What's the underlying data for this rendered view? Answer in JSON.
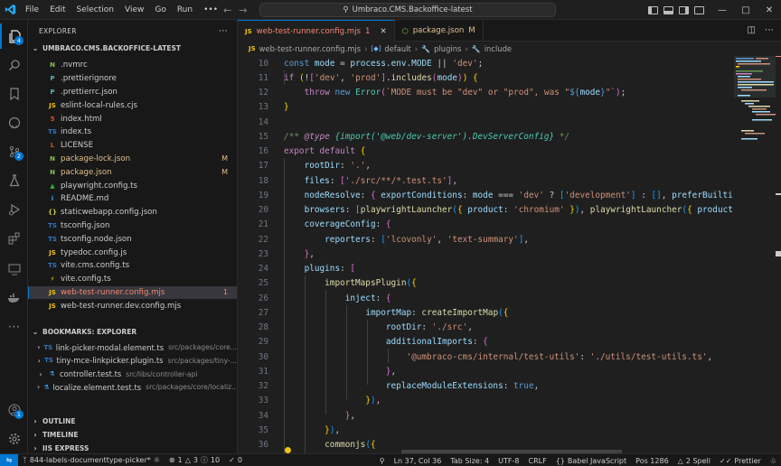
{
  "titlebar": {
    "menu": [
      "File",
      "Edit",
      "Selection",
      "View",
      "Go",
      "Run",
      "•••"
    ],
    "command_center": "Umbraco.CMS.Backoffice-latest",
    "window_controls": [
      "—",
      "□",
      "✕"
    ]
  },
  "activity": {
    "explorer_badge": "4",
    "scm_badge": "2",
    "accounts_badge": "1"
  },
  "sidebar": {
    "title": "EXPLORER",
    "root": "UMBRACO.CMS.BACKOFFICE-LATEST",
    "files": [
      {
        "name": ".nvmrc",
        "icon": "N",
        "color": "#8bc34a",
        "status": "",
        "cls": ""
      },
      {
        "name": ".prettierignore",
        "icon": "P",
        "color": "#56b3b4",
        "status": "",
        "cls": ""
      },
      {
        "name": ".prettierrc.json",
        "icon": "P",
        "color": "#56b3b4",
        "status": "",
        "cls": ""
      },
      {
        "name": "eslint-local-rules.cjs",
        "icon": "JS",
        "color": "#f1c40f",
        "status": "",
        "cls": ""
      },
      {
        "name": "index.html",
        "icon": "5",
        "color": "#e44d26",
        "status": "",
        "cls": ""
      },
      {
        "name": "index.ts",
        "icon": "TS",
        "color": "#3178c6",
        "status": "",
        "cls": ""
      },
      {
        "name": "LICENSE",
        "icon": "L",
        "color": "#d35400",
        "status": "",
        "cls": ""
      },
      {
        "name": "package-lock.json",
        "icon": "N",
        "color": "#8bc34a",
        "status": "M",
        "cls": "mod"
      },
      {
        "name": "package.json",
        "icon": "N",
        "color": "#8bc34a",
        "status": "M",
        "cls": "mod"
      },
      {
        "name": "playwright.config.ts",
        "icon": "▲",
        "color": "#2ead33",
        "status": "",
        "cls": ""
      },
      {
        "name": "README.md",
        "icon": "i",
        "color": "#42a5f5",
        "status": "",
        "cls": ""
      },
      {
        "name": "staticwebapp.config.json",
        "icon": "{}",
        "color": "#cbcb41",
        "status": "",
        "cls": ""
      },
      {
        "name": "tsconfig.json",
        "icon": "TS",
        "color": "#3178c6",
        "status": "",
        "cls": ""
      },
      {
        "name": "tsconfig.node.json",
        "icon": "TS",
        "color": "#3178c6",
        "status": "",
        "cls": ""
      },
      {
        "name": "typedoc.config.js",
        "icon": "JS",
        "color": "#f1c40f",
        "status": "",
        "cls": ""
      },
      {
        "name": "vite.cms.config.ts",
        "icon": "TS",
        "color": "#3178c6",
        "status": "",
        "cls": ""
      },
      {
        "name": "vite.config.ts",
        "icon": "⚡",
        "color": "#ffc517",
        "status": "",
        "cls": ""
      },
      {
        "name": "web-test-runner.config.mjs",
        "icon": "JS",
        "color": "#f1c40f",
        "status": "1",
        "cls": "err"
      },
      {
        "name": "web-test-runner.dev.config.mjs",
        "icon": "JS",
        "color": "#f1c40f",
        "status": "",
        "cls": ""
      }
    ],
    "bookmarks_title": "BOOKMARKS: EXPLORER",
    "bookmarks": [
      {
        "name": "link-picker-modal.element.ts",
        "path": "src/packages/core..."
      },
      {
        "name": "tiny-mce-linkpicker.plugin.ts",
        "path": "src/packages/tiny-..."
      },
      {
        "name": "controller.test.ts",
        "path": "src/libs/controller-api"
      },
      {
        "name": "localize.element.test.ts",
        "path": "src/packages/core/localiz..."
      }
    ],
    "bottom_sections": [
      "OUTLINE",
      "TIMELINE",
      "IIS EXPRESS"
    ]
  },
  "tabs": [
    {
      "label": "web-test-runner.config.mjs",
      "suffix": "1",
      "close": "✕",
      "active": true
    },
    {
      "label": "package.json",
      "suffix": "M",
      "close": "",
      "active": false
    }
  ],
  "breadcrumb": [
    "web-test-runner.config.mjs",
    "default",
    "plugins",
    "include"
  ],
  "editor": {
    "lines": [
      {
        "n": "10",
        "html": "<span class='kw'>const</span> <span class='var'>mode</span> = <span class='var'>process</span>.<span class='var'>env</span>.<span class='var'>MODE</span> || <span class='str'>'dev'</span>;"
      },
      {
        "n": "11",
        "html": "<span class='kw2'>if</span> <span class='br1'>(</span>!<span class='br2'>[</span><span class='str'>'dev'</span>, <span class='str'>'prod'</span><span class='br2'>]</span>.<span class='fn'>includes</span><span class='br2'>(</span><span class='var'>mode</span><span class='br2'>)</span><span class='br1'>)</span> <span class='br1'>{</span>"
      },
      {
        "n": "12",
        "html": "    <span class='kw2'>throw</span> <span class='kw'>new</span> <span class='cls'>Error</span><span class='br2'>(</span><span class='str'>`MODE must be \"dev\" or \"prod\", was \"</span><span class='kw'>${</span><span class='var'>mode</span><span class='kw'>}</span><span class='str'>\"`</span><span class='br2'>)</span>;"
      },
      {
        "n": "13",
        "html": "<span class='br1'>}</span>"
      },
      {
        "n": "14",
        "html": ""
      },
      {
        "n": "15",
        "html": "<span class='cm'>/** </span><span class='kw2' style='font-style:italic'>@type</span><span class='cls' style='font-style:italic'> {import('@web/dev-server').DevServerConfig}</span><span class='cm'> */</span>"
      },
      {
        "n": "16",
        "html": "<span class='kw2'>export</span> <span class='kw2'>default</span> <span class='br1'>{</span>"
      },
      {
        "n": "17",
        "html": "    <span class='var'>rootDir</span>: <span class='str'>'.'</span>,"
      },
      {
        "n": "18",
        "html": "    <span class='var'>files</span>: <span class='br2'>[</span><span class='str'>'./src/**/*.test.ts'</span><span class='br2'>]</span>,"
      },
      {
        "n": "19",
        "html": "    <span class='var'>nodeResolve</span>: <span class='br2'>{</span> <span class='var'>exportConditions</span>: <span class='var'>mode</span> === <span class='str'>'dev'</span> ? <span class='br3'>[</span><span class='str'>'development'</span><span class='br3'>]</span> : <span class='br3'>[]</span>, <span class='var'>preferBuilti</span>"
      },
      {
        "n": "20",
        "html": "    <span class='var'>browsers</span>: <span class='br2'>[</span><span class='fn'>playwrightLauncher</span><span class='br3'>(</span><span class='br1'>{</span> <span class='var'>product</span>: <span class='str'>'chromium'</span> <span class='br1'>}</span><span class='br3'>)</span>, <span class='fn'>playwrightLauncher</span><span class='br3'>(</span><span class='br1'>{</span> <span class='var'>product</span>"
      },
      {
        "n": "21",
        "html": "    <span class='var'>coverageConfig</span>: <span class='br2'>{</span>"
      },
      {
        "n": "22",
        "html": "        <span class='var'>reporters</span>: <span class='br3'>[</span><span class='str'>'lcovonly'</span>, <span class='str'>'text-summary'</span><span class='br3'>]</span>,"
      },
      {
        "n": "23",
        "html": "    <span class='br2'>}</span>,"
      },
      {
        "n": "24",
        "html": "    <span class='var'>plugins</span>: <span class='br2'>[</span>"
      },
      {
        "n": "25",
        "html": "        <span class='fn'>importMapsPlugin</span><span class='br3'>(</span><span class='br1'>{</span>"
      },
      {
        "n": "26",
        "html": "            <span class='var'>inject</span>: <span class='br2'>{</span>"
      },
      {
        "n": "27",
        "html": "                <span class='var'>importMap</span>: <span class='fn'>createImportMap</span><span class='br3'>(</span><span class='br1'>{</span>"
      },
      {
        "n": "28",
        "html": "                    <span class='var'>rootDir</span>: <span class='str'>'./src'</span>,"
      },
      {
        "n": "29",
        "html": "                    <span class='var'>additionalImports</span>: <span class='br2'>{</span>"
      },
      {
        "n": "30",
        "html": "                        <span class='str'>'@umbraco-cms/internal/test-utils'</span>: <span class='str'>'./utils/test-utils.ts'</span>,"
      },
      {
        "n": "31",
        "html": "                    <span class='br2'>}</span>,"
      },
      {
        "n": "32",
        "html": "                    <span class='var'>replaceModuleExtensions</span>: <span class='kw'>true</span>,"
      },
      {
        "n": "33",
        "html": "                <span class='br1'>}</span><span class='br3'>)</span>,"
      },
      {
        "n": "34",
        "html": "            <span class='br2'>}</span>,"
      },
      {
        "n": "35",
        "html": "        <span class='br1'>}</span><span class='br3'>)</span>,"
      },
      {
        "n": "36",
        "html": "        <span class='fn'>commonjs</span><span class='br3'>(</span><span class='br1'>{</span>"
      }
    ]
  },
  "statusbar": {
    "branch": "844-labels-documenttype-picker*",
    "errors": "1",
    "warnings": "3",
    "info": "10",
    "ports": "0",
    "position": "Ln 37, Col 36",
    "tab_size": "Tab Size: 4",
    "encoding": "UTF-8",
    "eol": "CRLF",
    "language": "Babel JavaScript",
    "pos": "Pos 1286",
    "spell": "2 Spell",
    "prettier": "Prettier"
  }
}
